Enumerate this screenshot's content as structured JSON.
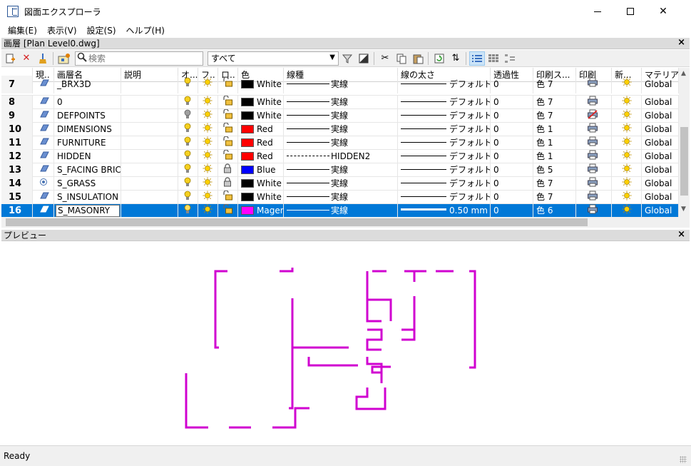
{
  "window": {
    "title": "図面エクスプローラ",
    "icon": "drawing-explorer-icon"
  },
  "menu": [
    "編集(E)",
    "表示(V)",
    "設定(S)",
    "ヘルプ(H)"
  ],
  "layers_panel": {
    "header": "画層 [Plan Level0.dwg]",
    "close": "×"
  },
  "toolbar": {
    "search_placeholder": "検索",
    "filter_value": "すべて"
  },
  "table": {
    "columns": [
      "",
      "現..",
      "画層名",
      "説明",
      "オ...",
      "フ..",
      "ロ..",
      "色",
      "線種",
      "線の太さ",
      "透過性",
      "印刷ス...",
      "印刷",
      "新...",
      "マテリアル"
    ],
    "rows": [
      {
        "num": "7",
        "name": "_BRX3D",
        "on": true,
        "freeze": true,
        "lock": "unlocked",
        "color_name": "White",
        "color": "#000000",
        "linetype": "実線",
        "lt_dash": false,
        "lineweight": "デフォルト",
        "lw_thick": false,
        "transparency": "0",
        "plotstyle": "色 7",
        "plot": true,
        "newvp": true,
        "material": "Global"
      },
      {
        "num": "8",
        "name": "0",
        "on": true,
        "freeze": true,
        "lock": "unlocked",
        "color_name": "White",
        "color": "#000000",
        "linetype": "実線",
        "lt_dash": false,
        "lineweight": "デフォルト",
        "lw_thick": false,
        "transparency": "0",
        "plotstyle": "色 7",
        "plot": true,
        "newvp": true,
        "material": "Global"
      },
      {
        "num": "9",
        "name": "DEFPOINTS",
        "on": false,
        "freeze": true,
        "lock": "unlocked",
        "color_name": "White",
        "color": "#000000",
        "linetype": "実線",
        "lt_dash": false,
        "lineweight": "デフォルト",
        "lw_thick": false,
        "transparency": "0",
        "plotstyle": "色 7",
        "plot": false,
        "newvp": true,
        "material": "Global"
      },
      {
        "num": "10",
        "name": "DIMENSIONS",
        "on": true,
        "freeze": true,
        "lock": "unlocked",
        "color_name": "Red",
        "color": "#ff0000",
        "linetype": "実線",
        "lt_dash": false,
        "lineweight": "デフォルト",
        "lw_thick": false,
        "transparency": "0",
        "plotstyle": "色 1",
        "plot": true,
        "newvp": true,
        "material": "Global"
      },
      {
        "num": "11",
        "name": "FURNITURE",
        "on": true,
        "freeze": true,
        "lock": "unlocked",
        "color_name": "Red",
        "color": "#ff0000",
        "linetype": "実線",
        "lt_dash": false,
        "lineweight": "デフォルト",
        "lw_thick": false,
        "transparency": "0",
        "plotstyle": "色 1",
        "plot": true,
        "newvp": true,
        "material": "Global"
      },
      {
        "num": "12",
        "name": "HIDDEN",
        "on": true,
        "freeze": true,
        "lock": "unlocked",
        "color_name": "Red",
        "color": "#ff0000",
        "linetype": "HIDDEN2",
        "lt_dash": true,
        "lineweight": "デフォルト",
        "lw_thick": false,
        "transparency": "0",
        "plotstyle": "色 1",
        "plot": true,
        "newvp": true,
        "material": "Global"
      },
      {
        "num": "13",
        "name": "S_FACING BRICK",
        "on": true,
        "freeze": true,
        "lock": "locked",
        "color_name": "Blue",
        "color": "#0000ff",
        "linetype": "実線",
        "lt_dash": false,
        "lineweight": "デフォルト",
        "lw_thick": false,
        "transparency": "0",
        "plotstyle": "色 5",
        "plot": true,
        "newvp": true,
        "material": "Global"
      },
      {
        "num": "14",
        "name": "S_GRASS",
        "on": true,
        "freeze": true,
        "lock": "locked",
        "color_name": "White",
        "color": "#000000",
        "linetype": "実線",
        "lt_dash": false,
        "lineweight": "デフォルト",
        "lw_thick": false,
        "transparency": "0",
        "plotstyle": "色 7",
        "plot": true,
        "newvp": true,
        "material": "Global"
      },
      {
        "num": "15",
        "name": "S_INSULATION",
        "on": true,
        "freeze": true,
        "lock": "unlocked",
        "color_name": "White",
        "color": "#000000",
        "linetype": "実線",
        "lt_dash": false,
        "lineweight": "デフォルト",
        "lw_thick": false,
        "transparency": "0",
        "plotstyle": "色 7",
        "plot": true,
        "newvp": true,
        "material": "Global"
      },
      {
        "num": "16",
        "name": "S_MASONRY",
        "on": true,
        "freeze": true,
        "lock": "unlocked",
        "color_name": "Magen",
        "color": "#ff00ff",
        "linetype": "実線",
        "lt_dash": false,
        "lineweight": "0.50 mm",
        "lw_thick": true,
        "transparency": "0",
        "plotstyle": "色 6",
        "plot": true,
        "newvp": true,
        "material": "Global",
        "selected": true
      }
    ]
  },
  "preview_panel": {
    "header": "プレビュー",
    "close": "×",
    "stroke_color": "#d000d0"
  },
  "status": "Ready"
}
